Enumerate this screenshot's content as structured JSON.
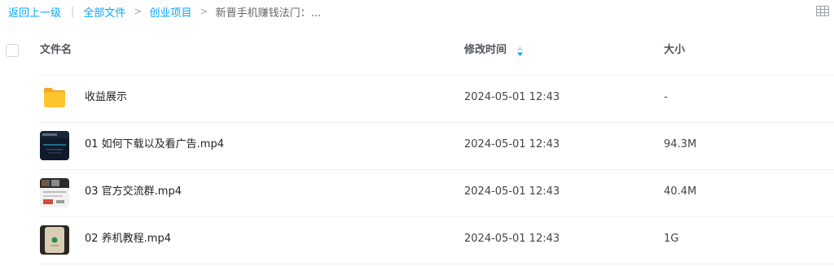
{
  "breadcrumb": {
    "back_label": "返回上一级",
    "items": [
      "全部文件",
      "创业项目"
    ],
    "current": "新晋手机赚钱法门：..."
  },
  "view_toggle_icon": "grid-view-icon",
  "columns": {
    "name": "文件名",
    "modified": "修改时间",
    "size": "大小",
    "sort_icon": "sort-arrows-icon"
  },
  "files": [
    {
      "name": "收益展示",
      "modified": "2024-05-01 12:43",
      "size": "-",
      "icon": "folder-icon"
    },
    {
      "name": "01 如何下载以及看广告.mp4",
      "modified": "2024-05-01 12:43",
      "size": "94.3M",
      "icon": "video-thumbnail"
    },
    {
      "name": "03 官方交流群.mp4",
      "modified": "2024-05-01 12:43",
      "size": "40.4M",
      "icon": "video-thumbnail"
    },
    {
      "name": "02 养机教程.mp4",
      "modified": "2024-05-01 12:43",
      "size": "1G",
      "icon": "video-thumbnail"
    }
  ],
  "colors": {
    "link": "#06a7ff",
    "folder": "#ffc52e"
  }
}
